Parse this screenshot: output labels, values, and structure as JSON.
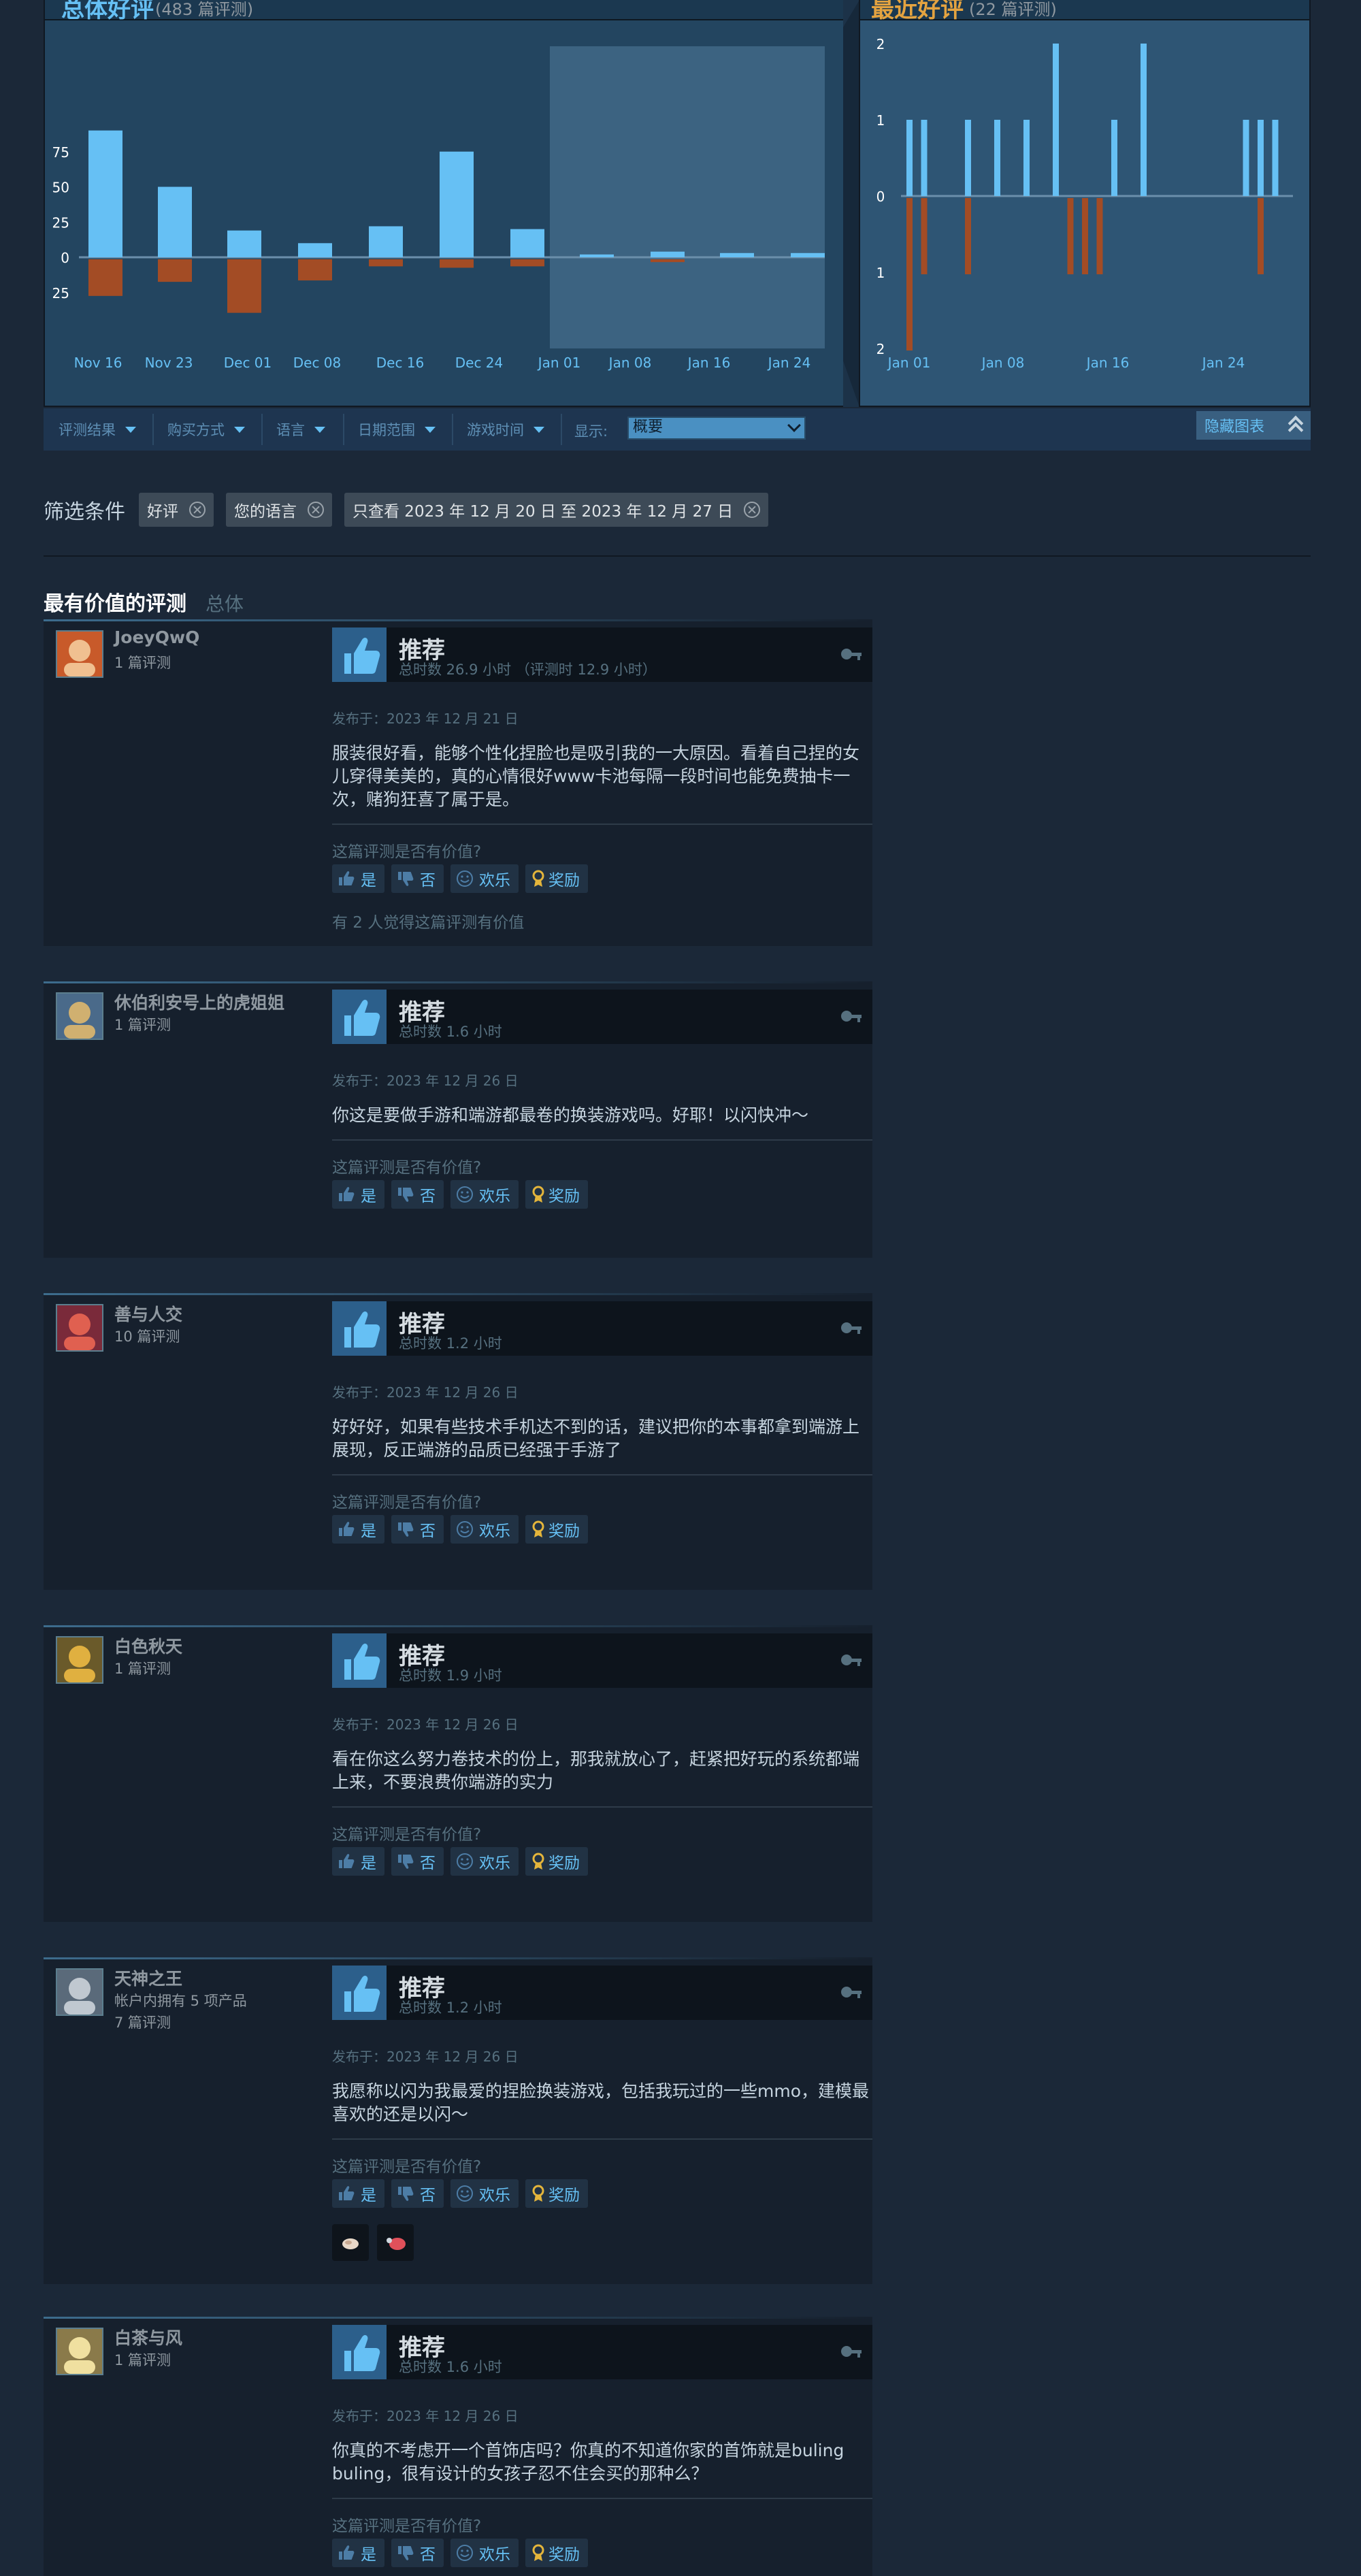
{
  "chart": {
    "title": "总体好评",
    "count": "(483 篇评测)",
    "right_title": "最近好评",
    "right_count": "(22 篇评测)",
    "positive_color": "#66c0f4",
    "negative_color": "#a34c25"
  },
  "chart_data": [
    {
      "type": "bar",
      "y_ticks": [
        "75",
        "50",
        "25",
        "0",
        "25"
      ],
      "x_tick_labels": [
        "Nov 16",
        "Nov 23",
        "Dec 01",
        "Dec 08",
        "Dec 16",
        "Dec 24",
        "Jan 01",
        "Jan 08",
        "Jan 16",
        "Jan 24"
      ],
      "series": [
        {
          "name": "positive",
          "values": [
            90,
            50,
            19,
            10,
            22,
            75,
            20,
            2,
            4,
            3,
            3
          ]
        },
        {
          "name": "negative",
          "values": [
            -26,
            -16,
            -38,
            -15,
            -5,
            -6,
            -5,
            0,
            -2,
            0,
            0
          ]
        }
      ],
      "ylim": [
        -40,
        95
      ]
    },
    {
      "type": "bar",
      "y_ticks": [
        "2",
        "1",
        "0",
        "1",
        "2"
      ],
      "x_tick_labels": [
        "Jan 01",
        "Jan 08",
        "Jan 16",
        "Jan 24"
      ],
      "series": [
        {
          "name": "positive",
          "values": [
            1,
            1,
            0,
            0,
            1,
            0,
            1,
            0,
            1,
            0,
            2,
            0,
            0,
            0,
            1,
            0,
            2,
            0,
            0,
            0,
            0,
            0,
            0,
            1,
            1,
            1
          ]
        },
        {
          "name": "negative",
          "values": [
            -2,
            -1,
            0,
            0,
            -1,
            0,
            0,
            0,
            0,
            0,
            0,
            -1,
            -1,
            -1,
            0,
            0,
            0,
            0,
            0,
            0,
            0,
            0,
            0,
            0,
            -1,
            0
          ]
        }
      ],
      "ylim": [
        -2,
        2
      ]
    }
  ],
  "filters": {
    "items": [
      "评测结果",
      "购买方式",
      "语言",
      "日期范围",
      "游戏时间"
    ],
    "show_label": "显示:",
    "show_value": "概要",
    "hide_graph": "隐藏图表"
  },
  "active_filters": {
    "label": "筛选条件",
    "chips": [
      "好评",
      "您的语言",
      "只查看 2023 年 12 月 20 日 至 2023 年 12 月 27 日"
    ]
  },
  "section": {
    "title": "最有价值的评测",
    "subtitle": "总体"
  },
  "review_ui": {
    "helpful_question": "这篇评测是否有价值?",
    "yes": "是",
    "no": "否",
    "funny": "欢乐",
    "award": "奖励"
  },
  "reviews": [
    {
      "author": "JoeyQwQ",
      "meta1": "1 篇评测",
      "meta2": "",
      "verdict": "推荐",
      "hours": "总时数 26.9 小时 （评测时 12.9 小时）",
      "posted": "发布于：2023 年 12 月 21 日",
      "content": "服装很好看，能够个性化捏脸也是吸引我的一大原因。看着自己捏的女儿穿得美美的，真的心情很好www卡池每隔一段时间也能免费抽卡一次，赌狗狂喜了属于是。",
      "helpful": "有 2 人觉得这篇评测有价值"
    },
    {
      "author": "休伯利安号上的虎姐姐",
      "meta1": "1 篇评测",
      "meta2": "",
      "verdict": "推荐",
      "hours": "总时数 1.6 小时",
      "posted": "发布于：2023 年 12 月 26 日",
      "content": "你这是要做手游和端游都最卷的换装游戏吗。好耶！以闪快冲～",
      "helpful": ""
    },
    {
      "author": "善与人交",
      "meta1": "10 篇评测",
      "meta2": "",
      "verdict": "推荐",
      "hours": "总时数 1.2 小时",
      "posted": "发布于：2023 年 12 月 26 日",
      "content": "好好好，如果有些技术手机达不到的话，建议把你的本事都拿到端游上展现，反正端游的品质已经强于手游了",
      "helpful": ""
    },
    {
      "author": "白色秋天",
      "meta1": "1 篇评测",
      "meta2": "",
      "verdict": "推荐",
      "hours": "总时数 1.9 小时",
      "posted": "发布于：2023 年 12 月 26 日",
      "content": "看在你这么努力卷技术的份上，那我就放心了，赶紧把好玩的系统都端上来，不要浪费你端游的实力",
      "helpful": ""
    },
    {
      "author": "天神之王",
      "meta1": "帐户内拥有 5 项产品",
      "meta2": "7 篇评测",
      "verdict": "推荐",
      "hours": "总时数 1.2 小时",
      "posted": "发布于：2023 年 12 月 26 日",
      "content": "我愿称以闪为我最爱的捏脸换装游戏，包括我玩过的一些mmo，建模最喜欢的还是以闪～",
      "helpful": ""
    },
    {
      "author": "白茶与风",
      "meta1": "1 篇评测",
      "meta2": "",
      "verdict": "推荐",
      "hours": "总时数 1.6 小时",
      "posted": "发布于：2023 年 12 月 26 日",
      "content": "你真的不考虑开一个首饰店吗？你真的不知道你家的首饰就是buling buling，很有设计的女孩子忍不住会买的那种么？",
      "helpful": ""
    }
  ]
}
